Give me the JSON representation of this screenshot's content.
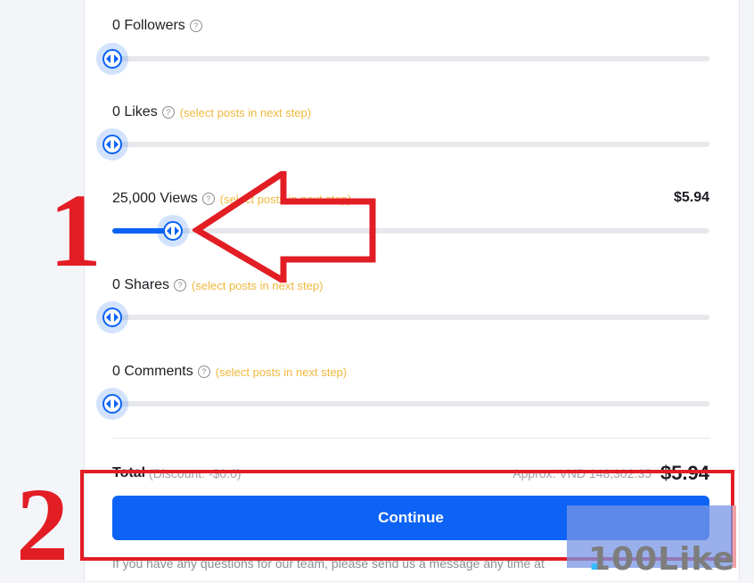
{
  "sliders": [
    {
      "label": "0 Followers",
      "note": "",
      "price": "",
      "value": 0
    },
    {
      "label": "0 Likes",
      "note": "(select posts in next step)",
      "price": "",
      "value": 0
    },
    {
      "label": "25,000 Views",
      "note": "(select posts in next step)",
      "price": "$5.94",
      "value": 0.1
    },
    {
      "label": "0 Shares",
      "note": "(select posts in next step)",
      "price": "",
      "value": 0
    },
    {
      "label": "0 Comments",
      "note": "(select posts in next step)",
      "price": "",
      "value": 0
    }
  ],
  "help_glyph": "?",
  "total": {
    "label": "Total",
    "discount": "(Discount: -$0.0)",
    "approx": "Approx. VND 148,302.35",
    "amount": "$5.94"
  },
  "continue_label": "Continue",
  "footer_note": "If you have any questions for our team, please send us a message any time at",
  "annotations": {
    "one": "1",
    "two": "2"
  },
  "watermark": {
    "text": "100Like",
    "dot": "."
  },
  "colors": {
    "accent": "#0c63f5",
    "annotation_red": "#e21d24",
    "note_yellow": "#f0b83c"
  }
}
